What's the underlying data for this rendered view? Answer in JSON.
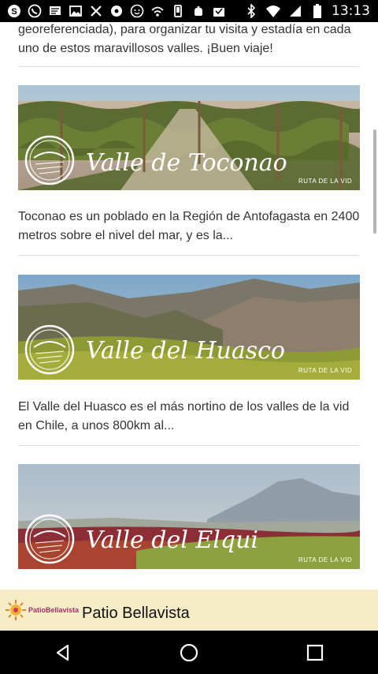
{
  "status_bar": {
    "time": "13:13",
    "left_icons": [
      "skype-icon",
      "whatsapp-icon",
      "message-icon",
      "image-icon",
      "tools-icon",
      "settings-flower-icon",
      "face-icon",
      "cloud-wifi-icon",
      "phone-icon",
      "android-icon",
      "mailbox-icon"
    ],
    "right_icons": [
      "bluetooth-icon",
      "wifi-icon",
      "signal-icon",
      "battery-icon"
    ]
  },
  "intro_text": "georeferenciada), para organizar tu visita y estadía en cada uno de estos maravillosos valles. ¡Buen viaje!",
  "cards": [
    {
      "image_title": "Valle de Toconao",
      "image_tag": "RUTA DE LA VID",
      "description": "Toconao es un poblado en la Región de Antofagasta en 2400 metros sobre el nivel del mar, y es la..."
    },
    {
      "image_title": "Valle del Huasco",
      "image_tag": "RUTA DE LA VID",
      "description": "El Valle del Huasco es el más nortino de los valles de la vid en Chile, a unos 800km al..."
    },
    {
      "image_title": "Valle del Elqui",
      "image_tag": "RUTA DE LA VID",
      "description": ""
    }
  ],
  "banner": {
    "logo_text": "PatioBellavista",
    "title": "Patio Bellavista"
  },
  "nav": {
    "back_icon": "back-triangle-icon",
    "home_icon": "home-circle-icon",
    "recents_icon": "recents-square-icon"
  },
  "colors": {
    "banner_bg": "#f6ecc8",
    "status_bar": "#000000"
  }
}
